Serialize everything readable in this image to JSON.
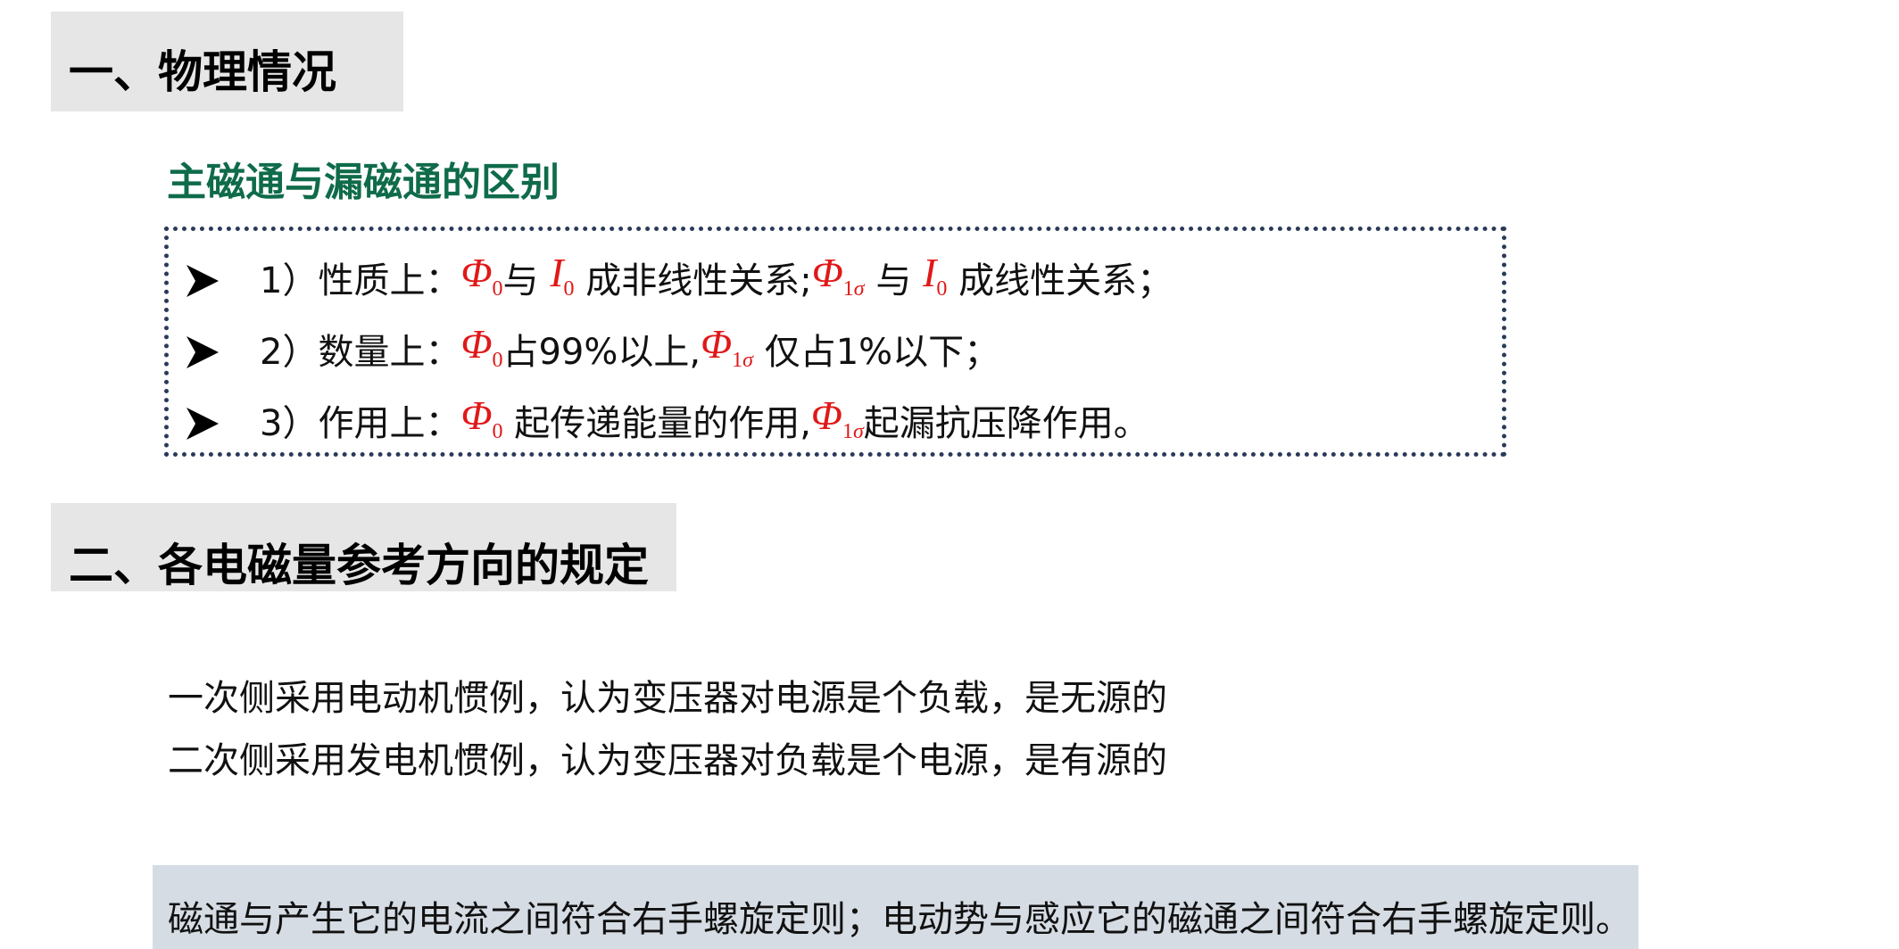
{
  "section1": {
    "title": "一、物理情况"
  },
  "subtitle": "主磁通与漏磁通的区别",
  "bullets": [
    {
      "prefix": "1）性质上：",
      "sym_a": "Φ",
      "sub_a": "0",
      "mid1": "与 ",
      "sym_b": "I",
      "sub_b": "0",
      "mid2": " 成非线性关系;",
      "sym_c": "Φ",
      "sub_c_num": "1",
      "sub_c_greek": "σ",
      "mid3": " 与 ",
      "sym_d": "I",
      "sub_d": "0",
      "tail": " 成线性关系；"
    },
    {
      "prefix": "2）数量上：",
      "sym_a": "Φ",
      "sub_a": "0",
      "mid1": "占99%以上,",
      "sym_b": "Φ",
      "sub_b_num": "1",
      "sub_b_greek": "σ",
      "tail": " 仅占1%以下；"
    },
    {
      "prefix": "3）作用上：",
      "sym_a": "Φ",
      "sub_a": "0",
      "mid1": " 起传递能量的作用,",
      "sym_b": "Φ",
      "sub_b_num": "1",
      "sub_b_greek": "σ",
      "tail": "起漏抗压降作用。"
    }
  ],
  "section2": {
    "title": "二、各电磁量参考方向的规定"
  },
  "lines": [
    "一次侧采用电动机惯例，认为变压器对电源是个负载，是无源的",
    "二次侧采用发电机惯例，认为变压器对负载是个电源，是有源的"
  ],
  "footer": "磁通与产生它的电流之间符合右手螺旋定则；电动势与感应它的磁通之间符合右手螺旋定则。",
  "colors": {
    "accent_green": "#0f6b4a",
    "symbol_red": "#e01818",
    "header_bg": "#e6e6e6",
    "footer_bg": "#d6dce4"
  }
}
